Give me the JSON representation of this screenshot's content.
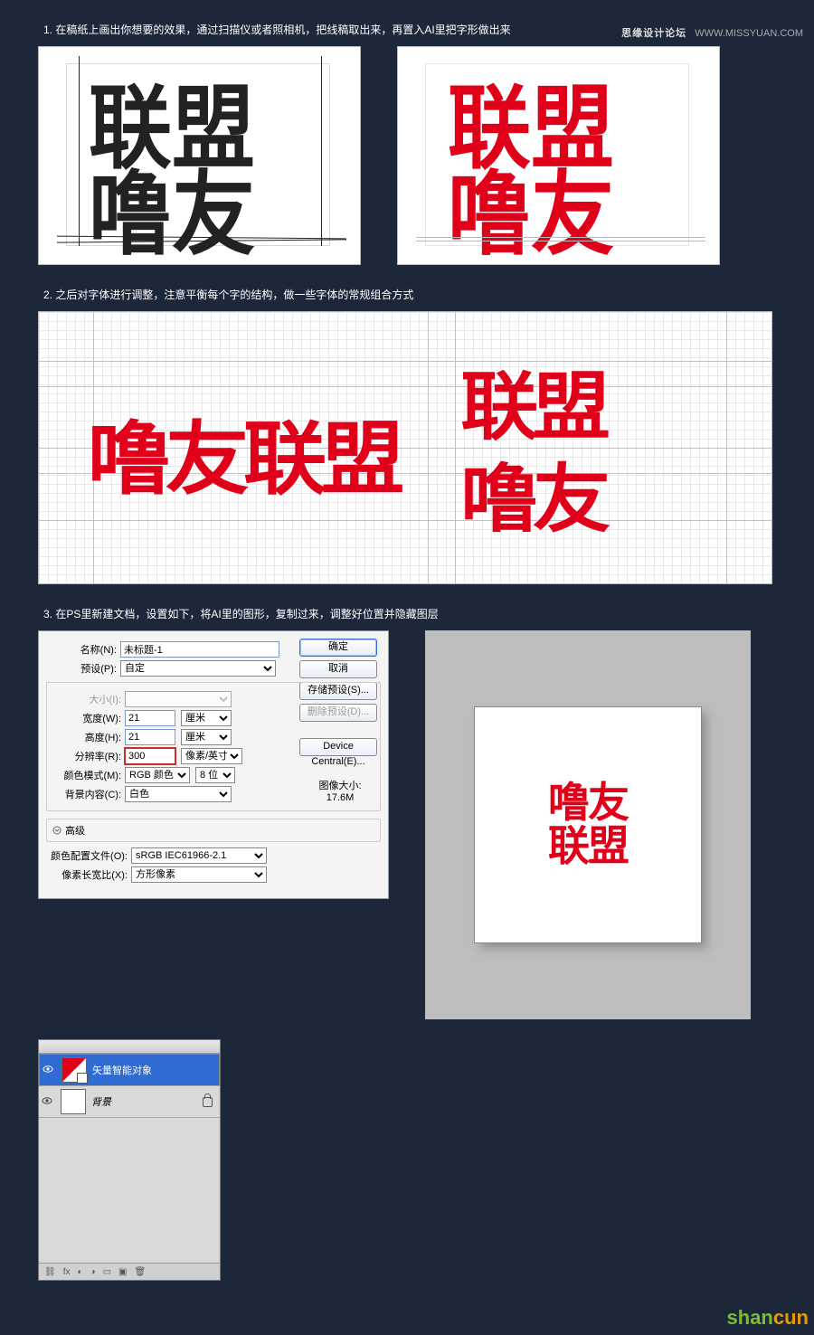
{
  "header": {
    "site": "思缘设计论坛",
    "url": "WWW.MISSYUAN.COM"
  },
  "steps": {
    "s1": "1. 在稿纸上画出你想要的效果，通过扫描仪或者照相机，把线稿取出来，再置入AI里把字形做出来",
    "s2": "2. 之后对字体进行调整，注意平衡每个字的结构，做一些字体的常规组合方式",
    "s3": "3. 在PS里新建文档，设置如下，将AI里的图形，复制过来，调整好位置并隐藏图层"
  },
  "typeface": {
    "word": "噜友联盟",
    "stack_top": "联盟",
    "stack_bot": "噜友",
    "preview_top": "噜友",
    "preview_bot": "联盟"
  },
  "dialog": {
    "name_label": "名称(N):",
    "name_value": "未标题-1",
    "preset_label": "预设(P):",
    "preset_value": "自定",
    "size_label": "大小(I):",
    "width_label": "宽度(W):",
    "width_value": "21",
    "width_unit": "厘米",
    "height_label": "高度(H):",
    "height_value": "21",
    "height_unit": "厘米",
    "res_label": "分辨率(R):",
    "res_value": "300",
    "res_unit": "像素/英寸",
    "mode_label": "颜色模式(M):",
    "mode_value": "RGB 颜色",
    "depth": "8 位",
    "bg_label": "背景内容(C):",
    "bg_value": "白色",
    "adv": "高级",
    "profile_label": "颜色配置文件(O):",
    "profile_value": "sRGB IEC61966-2.1",
    "aspect_label": "像素长宽比(X):",
    "aspect_value": "方形像素",
    "ok": "确定",
    "cancel": "取消",
    "save_preset": "存储预设(S)...",
    "del_preset": "删除预设(D)...",
    "device_central": "Device Central(E)...",
    "imgsize_label": "图像大小:",
    "imgsize_value": "17.6M"
  },
  "layers": {
    "l1": "矢量智能对象",
    "l2": "背景"
  },
  "watermark": {
    "a": "shan",
    "b": "cun"
  }
}
